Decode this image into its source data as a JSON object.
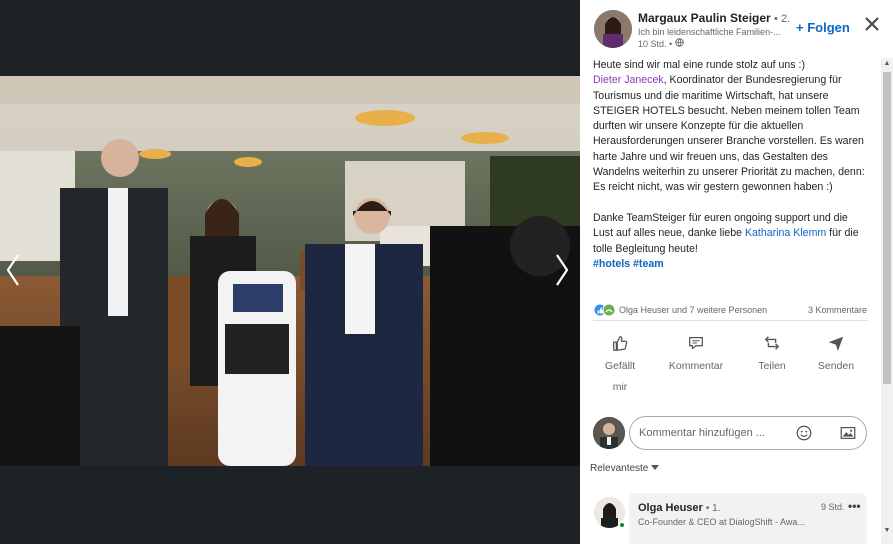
{
  "post": {
    "author": {
      "name": "Margaux Paulin Steiger",
      "degree": "• 2.",
      "headline": "Ich bin leidenschaftliche Familien-...",
      "time": "10 Std. •"
    },
    "follow_label": "+ Folgen",
    "text": {
      "line_intro": "Heute sind wir mal eine runde stolz auf uns :)",
      "mention1": "Dieter Janecek",
      "after_mention1": ", Koordinator der Bundesregierung für Tourismus und die maritime Wirtschaft, hat unsere STEIGER HOTELS besucht. Neben meinem tollen Team durften wir unsere Konzepte für die aktuellen Herausforderungen unserer Branche vorstellen. Es waren harte Jahre und wir freuen uns, das Gestalten des Wandelns weiterhin zu unserer Priorität zu machen, denn: Es reicht nicht, was wir gestern gewonnen haben :)",
      "before_mention2": "Danke TeamSteiger für euren ongoing support und die Lust auf alles neue, danke liebe ",
      "mention2": "Katharina Klemm",
      "after_mention2": " für die tolle Begleitung heute!",
      "hashtags": "#hotels #team"
    },
    "reactions": {
      "names": "Olga Heuser und 7 weitere Personen",
      "comments": "3 Kommentare"
    },
    "actions": [
      {
        "label_line1": "Gefällt",
        "label_line2": "mir",
        "icon": "thumbs-up-icon"
      },
      {
        "label": "Kommentar",
        "icon": "comment-icon"
      },
      {
        "label": "Teilen",
        "icon": "repost-icon"
      },
      {
        "label": "Senden",
        "icon": "send-icon"
      }
    ],
    "comment_box": {
      "placeholder": "Kommentar hinzufügen ..."
    },
    "sort_label": "Relevanteste",
    "comments": [
      {
        "name": "Olga Heuser",
        "degree": "• 1.",
        "headline": "Co-Founder & CEO at DialogShift - Awa...",
        "time": "9 Std.",
        "more": "•••"
      }
    ]
  },
  "colors": {
    "accent": "#0a66c2",
    "mention_purple": "#8a3ab9",
    "background_dark": "#1d2226"
  }
}
